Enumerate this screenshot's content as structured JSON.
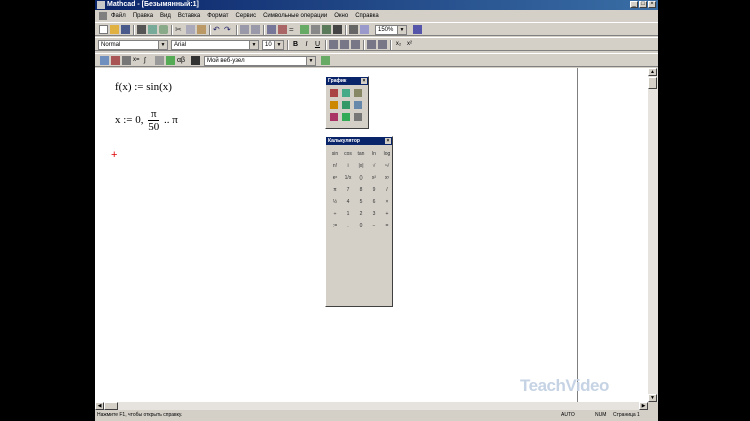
{
  "window": {
    "title": "Mathcad - [Безымянный:1]"
  },
  "menu": [
    "Файл",
    "Правка",
    "Вид",
    "Вставка",
    "Формат",
    "Сервис",
    "Символьные операции",
    "Окно",
    "Справка"
  ],
  "toolbar": {
    "zoom": "150%"
  },
  "format_bar": {
    "style": "Normal",
    "font": "Arial",
    "size": "10"
  },
  "resources": {
    "combo": "Мой веб-узел"
  },
  "document": {
    "line1": "f(x) := sin(x)",
    "line2_prefix": "x := 0,",
    "line2_numerator": "π",
    "line2_denominator": "50",
    "line2_suffix": ".. π"
  },
  "graph_palette": {
    "title": "График"
  },
  "calc_palette": {
    "title": "Калькулятор",
    "keys": [
      "sin",
      "cos",
      "tan",
      "ln",
      "log",
      "n!",
      "i",
      "|x|",
      "√",
      "ⁿ√",
      "eˣ",
      "1/x",
      "()",
      "x²",
      "xʸ",
      "π",
      "7",
      "8",
      "9",
      "/",
      "½",
      "4",
      "5",
      "6",
      "×",
      "÷",
      "1",
      "2",
      "3",
      "+",
      ":=",
      ".",
      "0",
      "−",
      "="
    ]
  },
  "status": {
    "hint": "Нажмите F1, чтобы открыть справку.",
    "mode": "AUTO",
    "num": "NUM",
    "page": "Страница 1"
  },
  "watermark": "TeachVideo"
}
